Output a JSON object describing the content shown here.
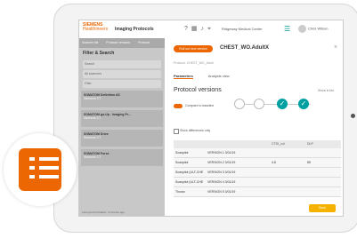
{
  "header": {
    "logo_line1": "SIEMENS",
    "logo_line2": "Healthineers",
    "app_title": "Imaging Protocols",
    "location": "Ridgeway Medical Center",
    "user": "Chris Wilson"
  },
  "left_panel": {
    "tabs": [
      "Scanner list",
      "Protocol versions",
      "Protocol"
    ],
    "filter_title": "Filter & Search",
    "filters": [
      "Search",
      "All scanners",
      "Filter"
    ],
    "items": [
      {
        "title": "SOMATOM Definition AS",
        "sub": "Siemens CT"
      },
      {
        "title": "SOMATOM go.Up - Imaging Pr...",
        "sub": "Siemens CT"
      },
      {
        "title": "SOMATOM Drive",
        "sub": "Siemens CT"
      },
      {
        "title": "SOMATOM Force",
        "sub": "Siemens CT"
      }
    ],
    "footer": "Last synchronization: 3 minutes ago"
  },
  "detail": {
    "action_button": "Roll out new version",
    "protocol_name": "CHEST_WO.AdultX",
    "subtitle": "Protocol: CHEST_WO_Adult",
    "tabs": [
      "Parameters",
      "Analysis view"
    ],
    "section_title": "Protocol versions",
    "section_link": "Show in list",
    "toggle_label": "Compare to baseline",
    "checkbox_label": "Show differences only",
    "table_headers": [
      "",
      "",
      "CTDI_vol",
      "DLP"
    ],
    "rows": [
      {
        "name": "Scanpilot",
        "version": "VERSION 1 3/01/19",
        "a": "",
        "b": ""
      },
      {
        "name": "Scanpilot",
        "version": "VERSION 2 3/01/19",
        "a": "4.8",
        "b": "85"
      },
      {
        "name": "Scanpilot (ULT-CHE",
        "version": "VERSION 3 3/01/19",
        "a": "",
        "b": ""
      },
      {
        "name": "Scanpilot (ULT-CHE",
        "version": "VERSION 4 3/01/19",
        "a": "",
        "b": ""
      },
      {
        "name": "Thorax",
        "version": "VERSION 5 3/01/19",
        "a": "",
        "b": ""
      }
    ],
    "footer_button": "Save"
  },
  "colors": {
    "accent": "#ec6602",
    "teal": "#00a0a0",
    "yellow": "#f5b300"
  }
}
